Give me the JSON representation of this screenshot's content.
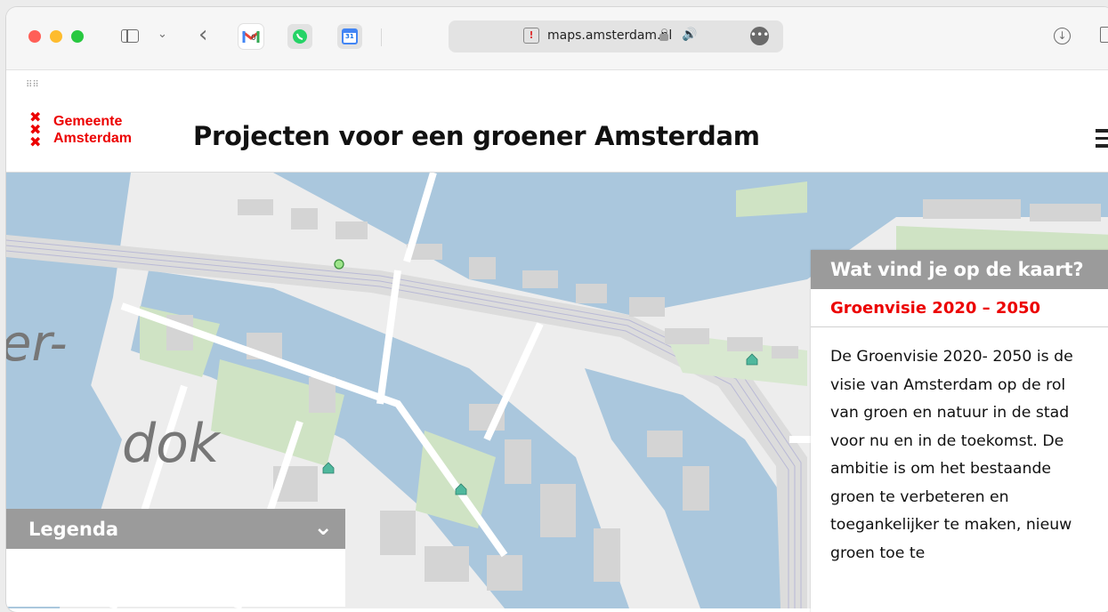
{
  "browser": {
    "url": "maps.amsterdam.nl",
    "favicons": [
      "gmail-icon",
      "whatsapp-icon",
      "google-calendar-icon"
    ],
    "calendar_day": "31",
    "gmail_badge": "0"
  },
  "header": {
    "logo_text": "Gemeente\nAmsterdam",
    "title": "Projecten voor een groener Amsterdam"
  },
  "map": {
    "label_top": "er-",
    "label_bottom": "dok"
  },
  "info_panel": {
    "heading": "Wat vind je op de kaart?",
    "subheading": "Groenvisie 2020 – 2050",
    "body": "De Groenvisie 2020- 2050 is de visie van Amsterdam op de rol van groen en natuur in de stad voor nu en in de toekomst. De ambitie is om het bestaande groen te verbeteren en toegankelijker te maken, nieuw groen toe te"
  },
  "legend": {
    "heading": "Legenda"
  },
  "colors": {
    "brand_red": "#ec0000",
    "panel_grey": "#9b9b9b",
    "water": "#aac7dd",
    "park": "#cfe3c4",
    "marker": "#4fb89d"
  }
}
